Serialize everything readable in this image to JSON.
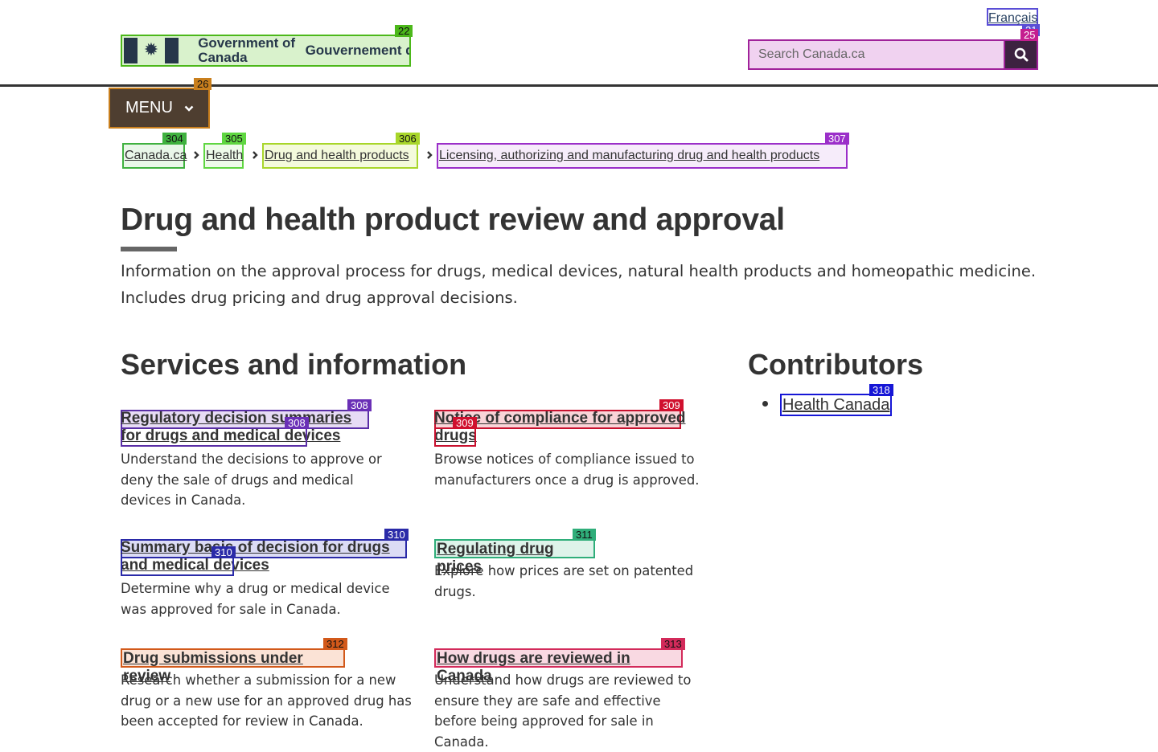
{
  "header": {
    "language_link": "Français",
    "wordmark_en": "Government of Canada",
    "wordmark_fr": "Gouvernement du Canada",
    "search_placeholder": "Search Canada.ca",
    "menu_label": "MENU"
  },
  "breadcrumb": [
    {
      "label": "Canada.ca"
    },
    {
      "label": "Health"
    },
    {
      "label": "Drug and health products"
    },
    {
      "label": "Licensing, authorizing and manufacturing drug and health products"
    }
  ],
  "main": {
    "title": "Drug and health product review and approval",
    "intro": "Information on the approval process for drugs, medical devices, natural health products and homeopathic medicine. Includes drug pricing and drug approval decisions.",
    "services_heading": "Services and information",
    "services": [
      {
        "title": "Regulatory decision summaries for drugs and medical devices",
        "description": "Understand the decisions to approve or deny the sale of drugs and medical devices in Canada."
      },
      {
        "title": "Notice of compliance for approved drugs",
        "description": "Browse notices of compliance issued to manufacturers once a drug is approved."
      },
      {
        "title": "Summary basis of decision for drugs and medical devices",
        "description": "Determine why a drug or medical device was approved for sale in Canada."
      },
      {
        "title": "Regulating drug prices",
        "description": "Explore how prices are set on patented drugs."
      },
      {
        "title": "Drug submissions under review",
        "description": "Research whether a submission for a new drug or a new use for an approved drug has been accepted for review in Canada."
      },
      {
        "title": "How drugs are reviewed in Canada",
        "description": "Understand how drugs are reviewed to ensure they are safe and effective before being approved for sale in Canada."
      }
    ],
    "contributors_heading": "Contributors",
    "contributors": [
      {
        "label": "Health Canada"
      }
    ]
  },
  "overlay_tags": {
    "fip": "22",
    "language": "21",
    "search": "25",
    "menu": "26",
    "bc0": "304",
    "bc1": "305",
    "bc2": "306",
    "bc3": "307",
    "s0": "308",
    "s0b": "308",
    "s1": "309",
    "s1b": "309",
    "s2": "310",
    "s2b": "310",
    "s3": "311",
    "s4": "312",
    "s5": "313",
    "contrib": "318"
  },
  "colors": {
    "link": "#284162",
    "text": "#333333",
    "menu_bg": "#4e3e30",
    "search_btn_bg": "#3d2240"
  },
  "icons": {
    "search": "search-icon",
    "menu_chevron": "chevron-down-icon",
    "breadcrumb_separator": "chevron-right-icon",
    "flag": "maple-leaf-icon"
  }
}
